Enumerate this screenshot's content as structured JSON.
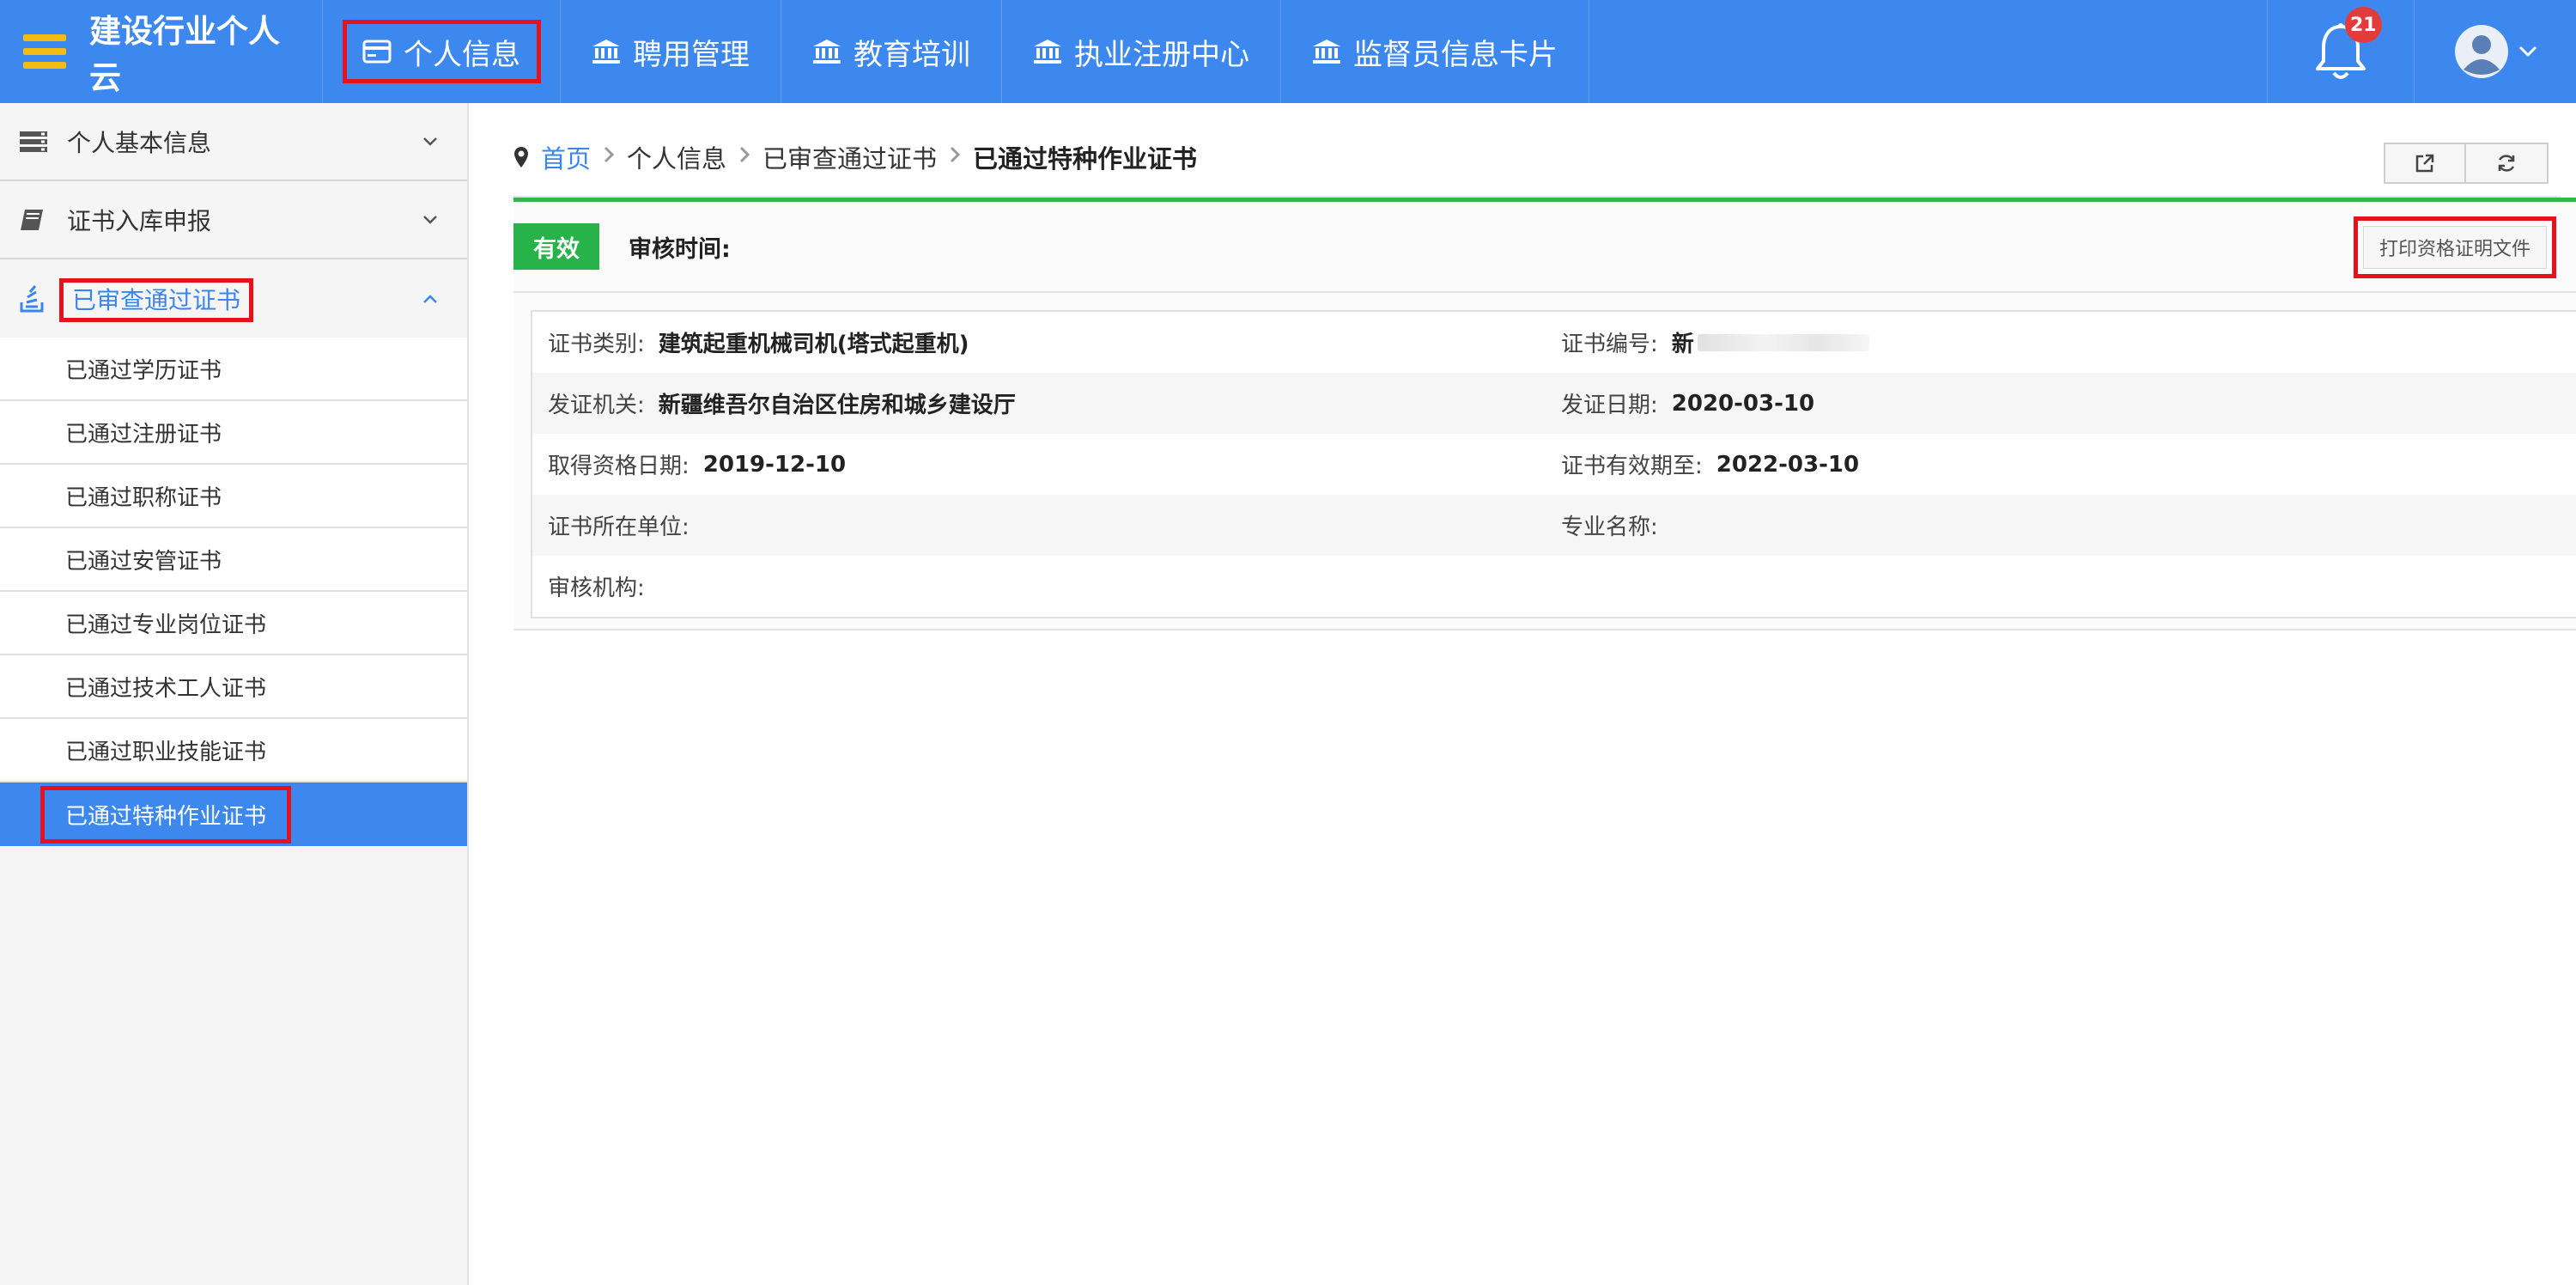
{
  "topbar": {
    "brand": "建设行业个人云",
    "nav": [
      {
        "label": "个人信息"
      },
      {
        "label": "聘用管理"
      },
      {
        "label": "教育培训"
      },
      {
        "label": "执业注册中心"
      },
      {
        "label": "监督员信息卡片"
      }
    ],
    "notification_count": "21",
    "colors": {
      "bar": "#3d88ee",
      "hamburger": "#f2bb15",
      "badge": "#e23b3b"
    }
  },
  "sidebar": {
    "groups": [
      {
        "label": "个人基本信息"
      },
      {
        "label": "证书入库申报"
      },
      {
        "label": "已审查通过证书"
      }
    ],
    "submenu": [
      {
        "label": "已通过学历证书"
      },
      {
        "label": "已通过注册证书"
      },
      {
        "label": "已通过职称证书"
      },
      {
        "label": "已通过安管证书"
      },
      {
        "label": "已通过专业岗位证书"
      },
      {
        "label": "已通过技术工人证书"
      },
      {
        "label": "已通过职业技能证书"
      },
      {
        "label": "已通过特种作业证书"
      }
    ]
  },
  "breadcrumb": {
    "home": "首页",
    "level1": "个人信息",
    "level2": "已审查通过证书",
    "current": "已通过特种作业证书"
  },
  "card": {
    "status": "有效",
    "audit_time_label": "审核时间:",
    "print_button": "打印资格证明文件",
    "rows": [
      {
        "left": {
          "label": "证书类别:",
          "value": "建筑起重机械司机(塔式起重机)"
        },
        "right": {
          "label": "证书编号:",
          "value": "新"
        }
      },
      {
        "left": {
          "label": "发证机关:",
          "value": "新疆维吾尔自治区住房和城乡建设厅"
        },
        "right": {
          "label": "发证日期:",
          "value": "2020-03-10"
        }
      },
      {
        "left": {
          "label": "取得资格日期:",
          "value": "2019-12-10"
        },
        "right": {
          "label": "证书有效期至:",
          "value": "2022-03-10"
        }
      },
      {
        "left": {
          "label": "证书所在单位:",
          "value": ""
        },
        "right": {
          "label": "专业名称:",
          "value": ""
        }
      },
      {
        "left": {
          "label": "审核机构:",
          "value": ""
        }
      }
    ]
  }
}
